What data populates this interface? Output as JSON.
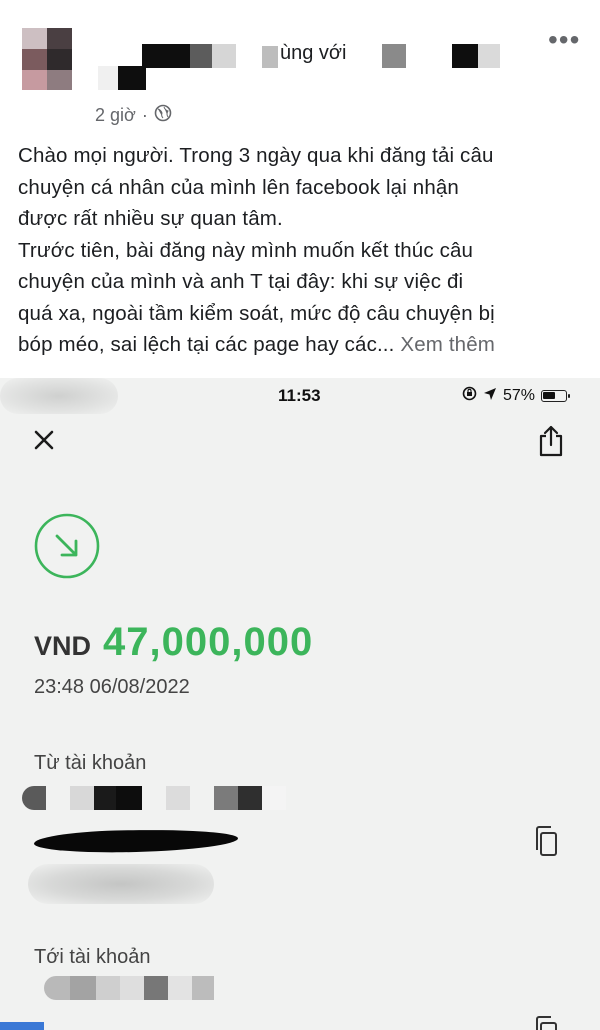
{
  "post": {
    "tagline": "ùng với",
    "time": "2 giờ",
    "separator": "·",
    "more_label": "•••",
    "body_lines": [
      "Chào mọi người. Trong 3 ngày qua khi đăng tải câu",
      "chuyện cá nhân của mình lên facebook  lại nhận",
      "được rất nhiều sự quan tâm.",
      "Trước tiên, bài đăng này mình muốn kết thúc câu",
      "chuyện của mình và anh T tại đây: khi sự việc đi",
      "quá xa, ngoài tầm kiểm soát, mức độ câu chuyện bị",
      "bóp méo, sai lệch tại các page hay các..."
    ],
    "see_more": "Xem thêm"
  },
  "bank": {
    "status": {
      "time": "11:53",
      "battery": "57%",
      "battery_level": 0.57
    },
    "currency": "VND",
    "amount": "47,000,000",
    "datetime": "23:48 06/08/2022",
    "from_label": "Từ tài khoản",
    "to_label": "Tới tài khoản",
    "accent_color": "#3cb55b"
  },
  "icons": {
    "globe": "globe-icon",
    "close": "close-icon",
    "share": "share-icon",
    "incoming": "incoming-arrow-icon",
    "copy": "copy-icon",
    "location": "location-arrow-icon",
    "lock": "rotation-lock-icon",
    "battery": "battery-icon"
  }
}
